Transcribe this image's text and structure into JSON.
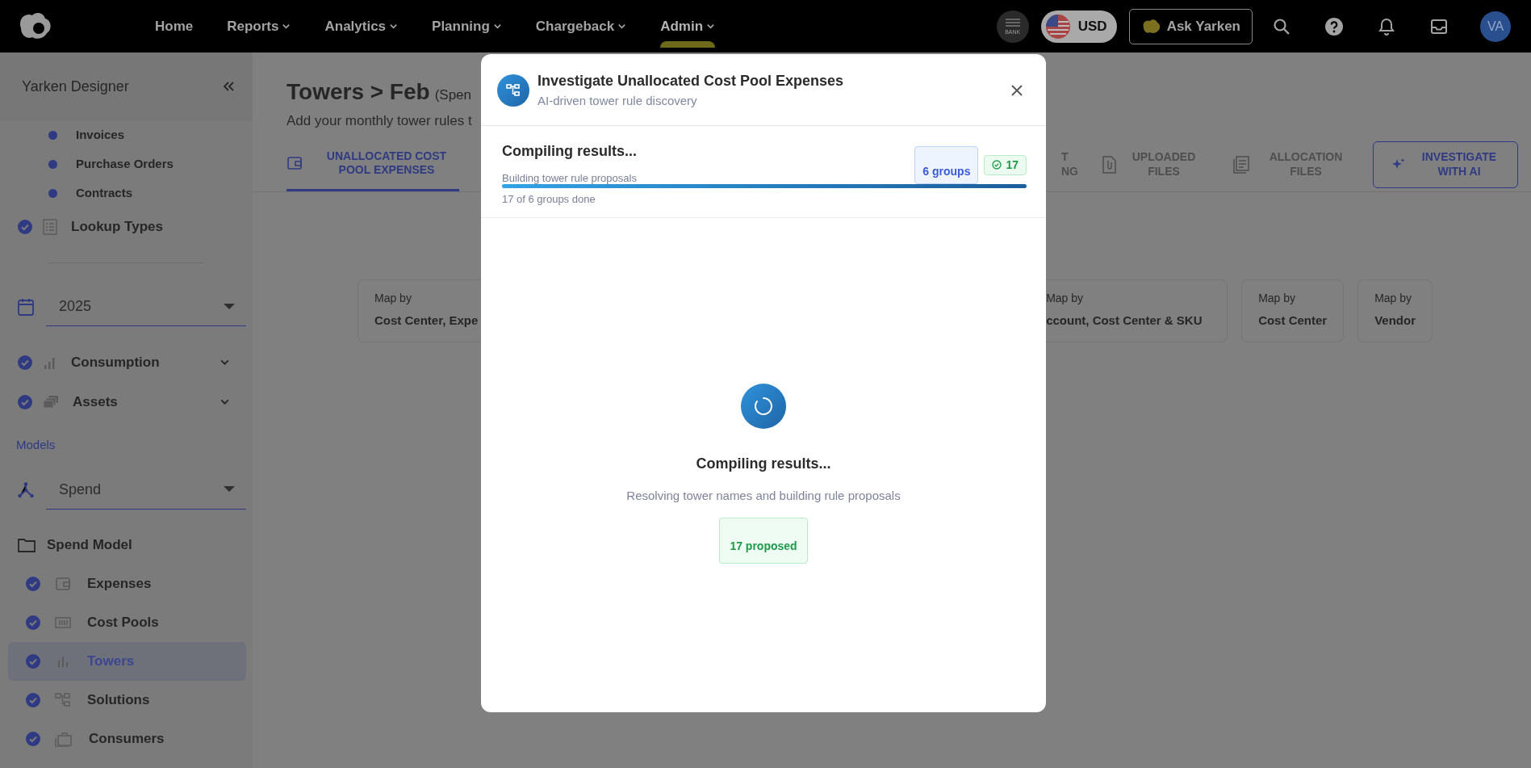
{
  "navbar": {
    "items": [
      {
        "label": "Home",
        "dropdown": false,
        "selected": false
      },
      {
        "label": "Reports",
        "dropdown": true,
        "selected": false
      },
      {
        "label": "Analytics",
        "dropdown": true,
        "selected": false
      },
      {
        "label": "Planning",
        "dropdown": true,
        "selected": false
      },
      {
        "label": "Chargeback",
        "dropdown": true,
        "selected": false
      },
      {
        "label": "Admin",
        "dropdown": true,
        "selected": true
      }
    ],
    "bank_label": "BANK",
    "currency": "USD",
    "ask_button": "Ask Yarken",
    "avatar": "VA"
  },
  "sidebar": {
    "title": "Yarken Designer",
    "data_items": [
      "Invoices",
      "Purchase Orders",
      "Contracts"
    ],
    "lookup": {
      "label": "Lookup Types",
      "checked": true
    },
    "year_select": {
      "value": "2025"
    },
    "data_groups": [
      {
        "label": "Consumption",
        "checked": true,
        "expanded": false
      },
      {
        "label": "Assets",
        "checked": true,
        "expanded": false
      }
    ],
    "models_label": "Models",
    "model_select": {
      "value": "Spend"
    },
    "model_group": {
      "label": "Spend Model",
      "items": [
        {
          "label": "Expenses",
          "checked": true,
          "selected": false
        },
        {
          "label": "Cost Pools",
          "checked": true,
          "selected": false
        },
        {
          "label": "Towers",
          "checked": true,
          "selected": true
        },
        {
          "label": "Solutions",
          "checked": true,
          "selected": false
        },
        {
          "label": "Consumers",
          "checked": true,
          "selected": false
        }
      ]
    }
  },
  "page": {
    "title": "Towers > Feb",
    "title_suffix": "(Spen",
    "subtitle": "Add your monthly tower rules t",
    "tabs": [
      {
        "label": "UNALLOCATED COST POOL EXPENSES",
        "selected": true
      },
      {
        "label": "T NG",
        "selected": false
      },
      {
        "label": "UPLOADED FILES",
        "selected": false
      },
      {
        "label": "ALLOCATION FILES",
        "selected": false
      }
    ],
    "investigate_button": "INVESTIGATE WITH AI",
    "cards": [
      {
        "caption": "Map by",
        "value": "Cost Center, Expe"
      },
      {
        "caption": "Map by",
        "value": "ccount, Cost Center & SKU"
      },
      {
        "caption": "Map by",
        "value": "Cost Center"
      },
      {
        "caption": "Map by",
        "value": "Vendor"
      }
    ]
  },
  "modal": {
    "title": "Investigate Unallocated Cost Pool Expenses",
    "subtitle": "AI-driven tower rule discovery",
    "status": {
      "title": "Compiling results...",
      "subtitle": "Building tower rule proposals",
      "groups_chip": "6 groups",
      "done_chip": "17",
      "level": 1,
      "progress_text": "17 of 6 groups done"
    },
    "center": {
      "title": "Compiling results...",
      "text": "Resolving tower names and building rule proposals",
      "chip": "17 proposed"
    }
  }
}
